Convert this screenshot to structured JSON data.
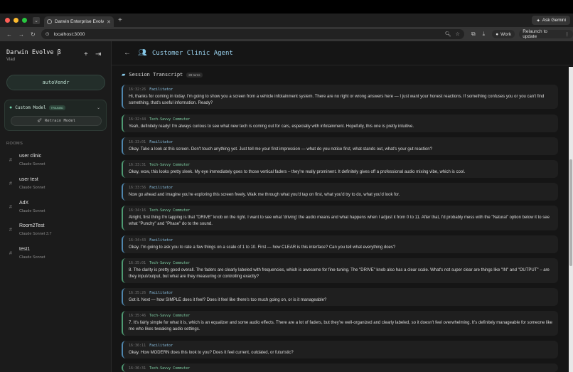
{
  "browser": {
    "tab_title": "Darwin Enterprise Evolve β",
    "url": "localhost:3000",
    "ask_gemini": "Ask Gemini",
    "profile": "Work",
    "relaunch": "Relaunch to update",
    "colors": {
      "close": "#ff5f57",
      "minimize": "#febc2e",
      "maximize": "#28c840"
    }
  },
  "sidebar": {
    "brand": "Darwin Evolve β",
    "user": "Vlad",
    "workspace": "autoVendr",
    "model": {
      "label": "Custom Model",
      "badge": "TRAINED",
      "retrain": "Retrain Model"
    },
    "rooms_title": "ROOMS",
    "rooms": [
      {
        "name": "user clinic",
        "model": "Claude Sonnet"
      },
      {
        "name": "user test",
        "model": "Claude Sonnet"
      },
      {
        "name": "AdX",
        "model": "Claude Sonnet"
      },
      {
        "name": "Room2Test",
        "model": "Claude Sonnet 3.7"
      },
      {
        "name": "test1",
        "model": "Claude Sonnet"
      }
    ]
  },
  "main": {
    "title": "Customer Clinic Agent",
    "transcript_title": "Session Transcript",
    "turns": "28 turns",
    "messages": [
      {
        "time": "16:32:26",
        "speaker": "Facilitator",
        "text": "Hi, thanks for coming in today. I'm going to show you a screen from a vehicle infotainment system. There are no right or wrong answers here — I just want your honest reactions. If something confuses you or you can't find something, that's useful information. Ready?"
      },
      {
        "time": "16:32:44",
        "speaker": "Tech-Savvy Commuter",
        "text": "Yeah, definitely ready! I'm always curious to see what new tech is coming out for cars, especially with infotainment. Hopefully, this one is pretty intuitive."
      },
      {
        "time": "16:33:01",
        "speaker": "Facilitator",
        "text": "Okay. Take a look at this screen. Don't touch anything yet. Just tell me your first impression — what do you notice first, what stands out, what's your gut reaction?"
      },
      {
        "time": "16:33:31",
        "speaker": "Tech-Savvy Commuter",
        "text": "Okay, wow, this looks pretty sleek. My eye immediately goes to those vertical faders – they're really prominent. It definitely gives off a professional audio mixing vibe, which is cool."
      },
      {
        "time": "16:33:56",
        "speaker": "Facilitator",
        "text": "Now go ahead and imagine you're exploring this screen freely. Walk me through what you'd tap on first, what you'd try to do, what you'd look for."
      },
      {
        "time": "16:34:16",
        "speaker": "Tech-Savvy Commuter",
        "text": "Alright, first thing I'm tapping is that \"DRIVE\" knob on the right. I want to see what 'driving' the audio means and what happens when I adjust it from 0 to 11. After that, I'd probably mess with the \"Natural\" option below it to see what \"Punchy\" and \"Phase\" do to the sound."
      },
      {
        "time": "16:34:43",
        "speaker": "Facilitator",
        "text": "Okay. I'm going to ask you to rate a few things on a scale of 1 to 10. First — how CLEAR is this interface? Can you tell what everything does?"
      },
      {
        "time": "16:35:01",
        "speaker": "Tech-Savvy Commuter",
        "text": "8. The clarity is pretty good overall. The faders are clearly labeled with frequencies, which is awesome for fine-tuning. The \"DRIVE\" knob also has a clear scale. What's not super clear are things like \"IN\" and \"OUTPUT\" – are they input/output, but what are they measuring or controlling exactly?"
      },
      {
        "time": "16:35:26",
        "speaker": "Facilitator",
        "text": "Got it. Next — how SIMPLE does it feel? Does it feel like there's too much going on, or is it manageable?"
      },
      {
        "time": "16:35:46",
        "speaker": "Tech-Savvy Commuter",
        "text": "7. It's fairly simple for what it is, which is an equalizer and some audio effects. There are a lot of faders, but they're well-organized and clearly labeled, so it doesn't feel overwhelming. It's definitely manageable for someone like me who likes tweaking audio settings."
      },
      {
        "time": "16:36:11",
        "speaker": "Facilitator",
        "text": "Okay. How MODERN does this look to you? Does it feel current, outdated, or futuristic?"
      },
      {
        "time": "16:36:31",
        "speaker": "Tech-Savvy Commuter",
        "text": ""
      }
    ]
  }
}
